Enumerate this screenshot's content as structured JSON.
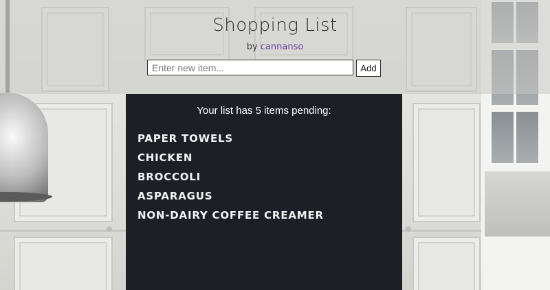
{
  "header": {
    "title": "Shopping List",
    "by_prefix": "by",
    "author": "cannanso"
  },
  "form": {
    "placeholder": "Enter new item...",
    "value": "",
    "add_label": "Add"
  },
  "list": {
    "summary": "Your list has 5 items pending:",
    "items": [
      "Paper Towels",
      "Chicken",
      "Broccoli",
      "Asparagus",
      "Non-dairy coffee creamer"
    ]
  },
  "colors": {
    "author_link": "#6a3fa0",
    "chalkboard": "#1c1f26",
    "chalk_text": "#f4f4f4"
  }
}
